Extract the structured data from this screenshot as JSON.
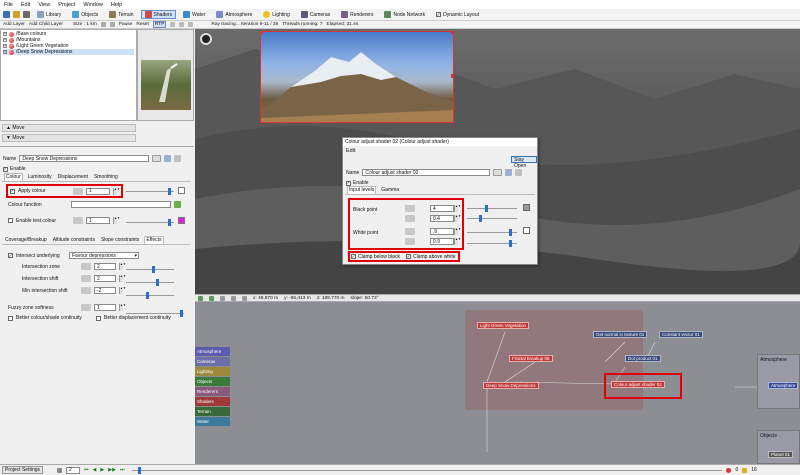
{
  "menu": [
    "File",
    "Edit",
    "View",
    "Project",
    "Window",
    "Help"
  ],
  "toolbar": {
    "buttons": [
      {
        "label": "Library",
        "icon": "library-icon"
      },
      {
        "label": "Objects",
        "icon": "objects-icon"
      },
      {
        "label": "Terrain",
        "icon": "terrain-icon"
      },
      {
        "label": "Shaders",
        "icon": "shaders-icon",
        "active": true
      },
      {
        "label": "Water",
        "icon": "water-icon"
      },
      {
        "label": "Atmosphere",
        "icon": "atmosphere-icon"
      },
      {
        "label": "Lighting",
        "icon": "lighting-icon"
      },
      {
        "label": "Cameras",
        "icon": "cameras-icon"
      },
      {
        "label": "Renderers",
        "icon": "renderers-icon"
      },
      {
        "label": "Node Network",
        "icon": "node-network-icon"
      }
    ],
    "dynamic_layout_label": "Dynamic Layout"
  },
  "toolbar2": {
    "add_layer": "Add Layer",
    "add_child_layer": "Add Child Layer",
    "size": "Size : 1 km",
    "pause": "Pause",
    "reset": "Reset",
    "rtp": "RTP",
    "ray_tracing": "Ray tracing... Iteration 9-11 / 36",
    "threads": "Threads running: 7",
    "elapsed": "Elapsed: 31.4s"
  },
  "tree": {
    "items": [
      "/Base colours",
      "/Mountains",
      "/Light Green Vegetation",
      "/Deep Snow Depressions"
    ]
  },
  "move_buttons": [
    "Move",
    "Move"
  ],
  "props": {
    "name_label": "Name",
    "name_value": "Deep Snow Depressions",
    "enable_label": "Enable",
    "tabs": [
      "Colour",
      "Luminosity",
      "Displacement",
      "Smoothing"
    ],
    "apply_colour_label": "Apply colour",
    "apply_colour_value": "1",
    "colour_function_label": "Colour function",
    "enable_test_colour_label": "Enable test colour",
    "enable_test_colour_value": "1",
    "tabs2": [
      "Coverage/Breakup",
      "Altitude constraints",
      "Slope constraints",
      "Effects"
    ],
    "intersect_label": "Intersect underlying",
    "intersect_select": "Favour depressions",
    "intersection_zone_label": "Intersection zone",
    "intersection_zone_value": "2",
    "intersection_shift_label": "Intersection shift",
    "intersection_shift_value": "2",
    "min_intersection_shift_label": "Min intersection shift",
    "min_intersection_shift_value": "-2",
    "fuzzy_label": "Fuzzy zone softness",
    "fuzzy_value": "1",
    "better_shade_label": "Better colour/shade continuity",
    "better_disp_label": "Better displacement continuity"
  },
  "dialog": {
    "title": "Colour adjust shader 02   (Colour adjust shader)",
    "edit": "Edit",
    "stay_open": "Stay Open",
    "name_label": "Name",
    "name_value": "Colour adjust shader 02",
    "enable_label": "Enable",
    "tabs": [
      "Input levels",
      "Gamma"
    ],
    "black_point_label": "Black point",
    "black_a": "4",
    "black_b": "0.4",
    "white_point_label": "White point",
    "white_a": ".9",
    "white_b": "0.9",
    "clamp_below": "Clamp below black",
    "clamp_above": "Clamp above white"
  },
  "statusbar": {
    "x": "x: 46,870 m",
    "y": "y: -65,413 m",
    "z": "z: 189,770 m",
    "slope": "slope: 50.73°"
  },
  "categories": [
    {
      "label": "Atmosphere",
      "color": "#5b5bb0"
    },
    {
      "label": "Cameras",
      "color": "#6e6ea8"
    },
    {
      "label": "Lighting",
      "color": "#9a8a3a"
    },
    {
      "label": "Objects",
      "color": "#3a7a3a"
    },
    {
      "label": "Renderers",
      "color": "#8a5a7a"
    },
    {
      "label": "Shaders",
      "color": "#a03a3a"
    },
    {
      "label": "Terrain",
      "color": "#3a6a3a"
    },
    {
      "label": "Water",
      "color": "#3a7a9a"
    }
  ],
  "nodes": {
    "light_green": "Light Green Vegetation",
    "fractal": "Fractal breakup 06",
    "deep_snow": "Deep Snow Depressions",
    "colour_adjust": "Colour adjust shader 02",
    "get_normal": "Get normal in texture 01",
    "constant_vector": "Constant vector 01",
    "dot_product": "Dot product 01",
    "atmosphere_panel": "Atmosphere",
    "atmosphere_node": "Atmosphere",
    "objects_panel": "Objects",
    "planet": "Planet 01"
  },
  "bottombar": {
    "project_settings": "Project Settings",
    "frame": "2",
    "error_count": "0",
    "warn_count": "16"
  }
}
